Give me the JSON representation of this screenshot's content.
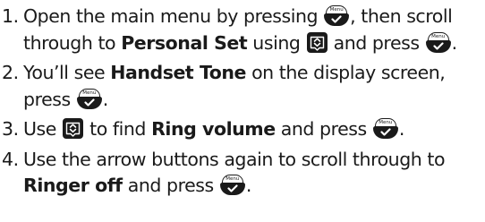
{
  "steps": [
    {
      "num": "1.",
      "line1_a": "Open the main menu by pressing",
      "line1_b": ", then scroll",
      "line2_a": "through to",
      "line2_bold": "Personal Set",
      "line2_b": "using",
      "line2_c": "and press",
      "line2_d": "."
    },
    {
      "num": "2.",
      "line1_a": "You’ll see",
      "line1_bold": "Handset Tone",
      "line1_b": "on the display screen,",
      "line2_a": "press",
      "line2_b": "."
    },
    {
      "num": "3.",
      "line1_a": "Use",
      "line1_b": "to find",
      "line1_bold": "Ring volume",
      "line1_c": "and press",
      "line1_d": "."
    },
    {
      "num": "4.",
      "line1_a": "Use the arrow buttons again to scroll through to",
      "line2_bold": "Ringer off",
      "line2_a": "and press",
      "line2_b": "."
    }
  ],
  "icons": {
    "menu_key_label": "Menu",
    "menu_key": "menu-ok-key-icon",
    "nav_key": "up-down-nav-key-icon"
  },
  "colors": {
    "text": "#1a1a1a",
    "key_fill": "#1a1a1a",
    "background": "#ffffff"
  }
}
